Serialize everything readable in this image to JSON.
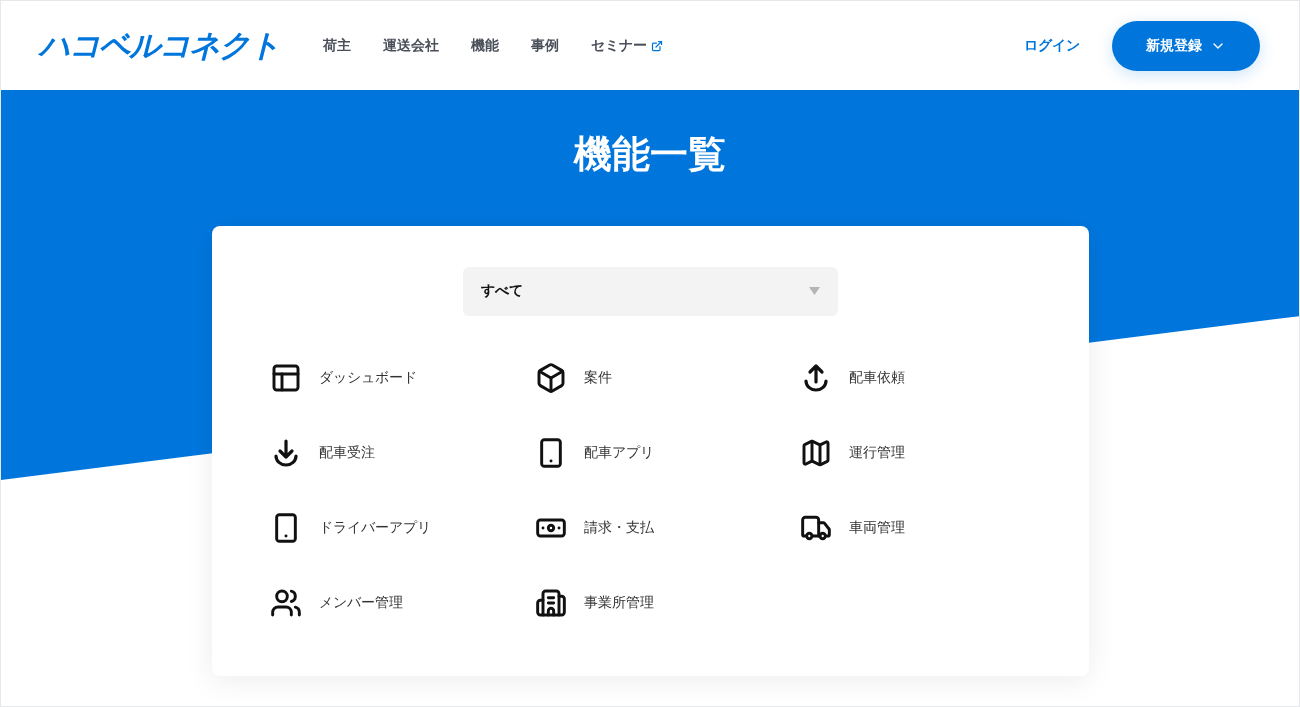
{
  "header": {
    "logo": "ハコベルコネクト",
    "nav": [
      {
        "label": "荷主",
        "external": false
      },
      {
        "label": "運送会社",
        "external": false
      },
      {
        "label": "機能",
        "external": false
      },
      {
        "label": "事例",
        "external": false
      },
      {
        "label": "セミナー",
        "external": true
      }
    ],
    "login": "ログイン",
    "signup": "新規登録"
  },
  "page_title": "機能一覧",
  "filter": {
    "value": "すべて"
  },
  "features": [
    {
      "label": "ダッシュボード",
      "kind": "layout"
    },
    {
      "label": "案件",
      "kind": "cube"
    },
    {
      "label": "配車依頼",
      "kind": "upload"
    },
    {
      "label": "配車受注",
      "kind": "download"
    },
    {
      "label": "配車アプリ",
      "kind": "phone"
    },
    {
      "label": "運行管理",
      "kind": "map"
    },
    {
      "label": "ドライバーアプリ",
      "kind": "phone"
    },
    {
      "label": "請求・支払",
      "kind": "money"
    },
    {
      "label": "車両管理",
      "kind": "truck"
    },
    {
      "label": "メンバー管理",
      "kind": "users"
    },
    {
      "label": "事業所管理",
      "kind": "building"
    }
  ]
}
